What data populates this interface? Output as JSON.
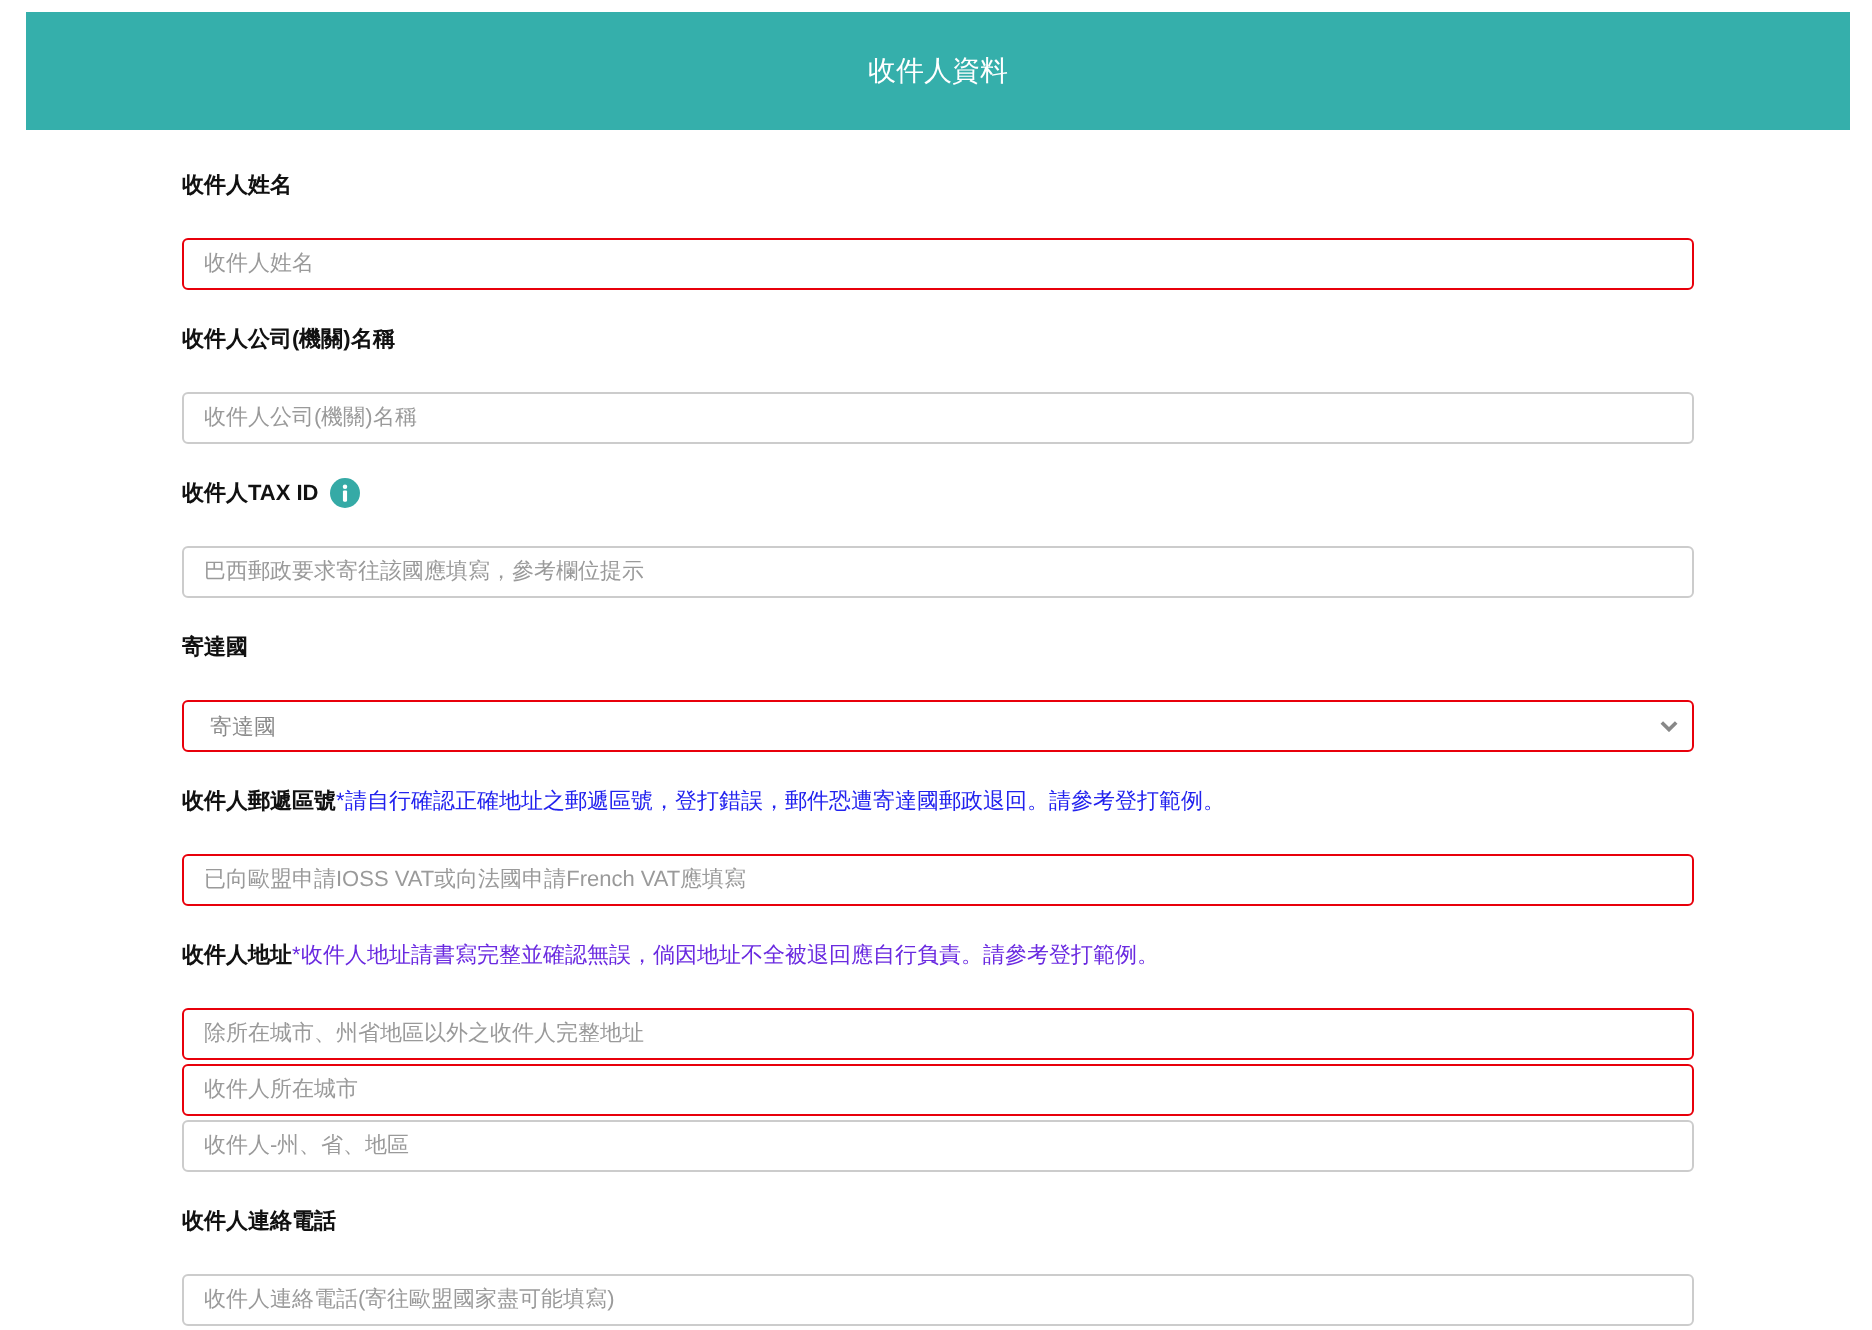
{
  "header": {
    "title": "收件人資料"
  },
  "fields": [
    {
      "label": "收件人姓名",
      "info": false,
      "inputs": [
        {
          "kind": "text",
          "placeholder": "收件人姓名",
          "invalid": true
        }
      ]
    },
    {
      "label": "收件人公司(機關)名稱",
      "info": false,
      "inputs": [
        {
          "kind": "text",
          "placeholder": "收件人公司(機關)名稱",
          "invalid": false
        }
      ]
    },
    {
      "label": "收件人TAX ID",
      "info": true,
      "inputs": [
        {
          "kind": "text",
          "placeholder": "巴西郵政要求寄往該國應填寫，參考欄位提示",
          "invalid": false
        }
      ]
    },
    {
      "label": "寄達國",
      "info": false,
      "inputs": [
        {
          "kind": "select",
          "placeholder": "寄達國",
          "invalid": true
        }
      ]
    },
    {
      "label": "收件人郵遞區號",
      "info": false,
      "note": {
        "text": "*請自行確認正確地址之郵遞區號，登打錯誤，郵件恐遭寄達國郵政退回。請參考登打範例。",
        "color": "#2222ee"
      },
      "inputs": [
        {
          "kind": "text",
          "placeholder": "已向歐盟申請IOSS VAT或向法國申請French VAT應填寫",
          "invalid": true
        }
      ]
    },
    {
      "label": "收件人地址",
      "info": false,
      "note": {
        "text": "*收件人地址請書寫完整並確認無誤，倘因地址不全被退回應自行負責。請參考登打範例。",
        "color": "#6a2ae0"
      },
      "inputs": [
        {
          "kind": "text",
          "placeholder": "除所在城市、州省地區以外之收件人完整地址",
          "invalid": true
        },
        {
          "kind": "text",
          "placeholder": "收件人所在城市",
          "invalid": true
        },
        {
          "kind": "text",
          "placeholder": "收件人-州、省、地區",
          "invalid": false
        }
      ]
    },
    {
      "label": "收件人連絡電話",
      "info": false,
      "inputs": [
        {
          "kind": "text",
          "placeholder": "收件人連絡電話(寄往歐盟國家盡可能填寫)",
          "invalid": false
        }
      ]
    }
  ]
}
